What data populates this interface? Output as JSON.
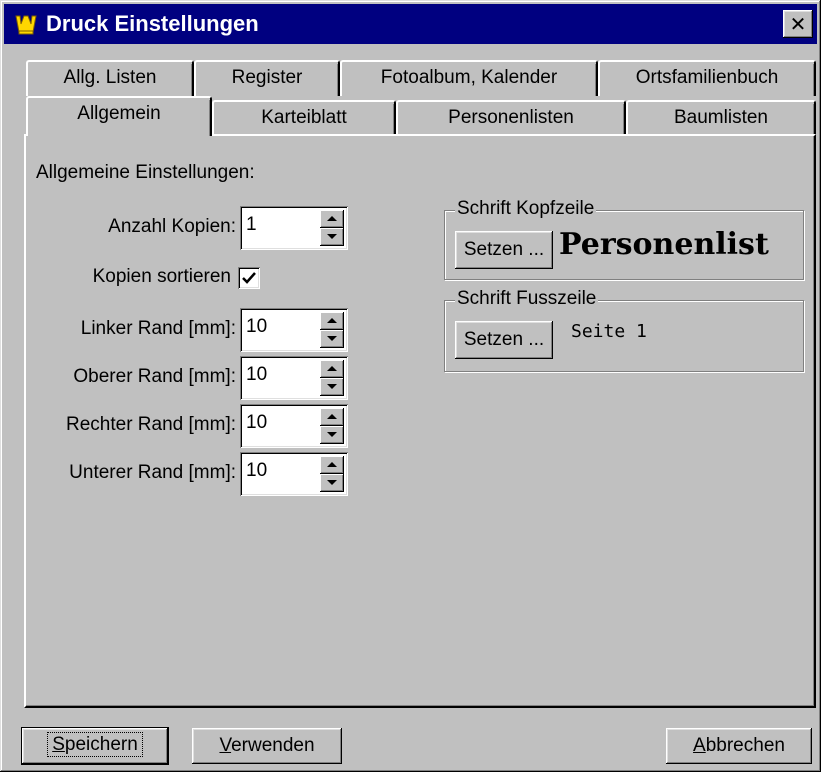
{
  "window": {
    "title": "Druck Einstellungen",
    "close_glyph": "✕"
  },
  "tabs": {
    "back_row": [
      "Allg. Listen",
      "Register",
      "Fotoalbum, Kalender",
      "Ortsfamilienbuch"
    ],
    "front_row": [
      "Allgemein",
      "Karteiblatt",
      "Personenlisten",
      "Baumlisten"
    ],
    "active": "Allgemein"
  },
  "general": {
    "heading": "Allgemeine Einstellungen:",
    "copies_label": "Anzahl Kopien:",
    "copies_value": "1",
    "sort_label": "Kopien sortieren",
    "sort_checked": true,
    "left_margin_label": "Linker Rand [mm]:",
    "left_margin_value": "10",
    "top_margin_label": "Oberer Rand [mm]:",
    "top_margin_value": "10",
    "right_margin_label": "Rechter Rand [mm]:",
    "right_margin_value": "10",
    "bottom_margin_label": "Unterer Rand [mm]:",
    "bottom_margin_value": "10"
  },
  "header_font": {
    "legend": "Schrift Kopfzeile",
    "button_label": "Setzen ...",
    "preview": "Personenlist"
  },
  "footer_font": {
    "legend": "Schrift Fusszeile",
    "button_label": "Setzen ...",
    "preview": "Seite 1"
  },
  "footer_buttons": {
    "save": {
      "mnemonic": "S",
      "rest": "peichern"
    },
    "apply": {
      "mnemonic": "V",
      "rest": "erwenden"
    },
    "cancel": {
      "mnemonic": "A",
      "rest": "bbrechen"
    }
  },
  "colors": {
    "titlebar": "#000080",
    "face": "#c0c0c0",
    "icon_yellow": "#ffd700"
  }
}
